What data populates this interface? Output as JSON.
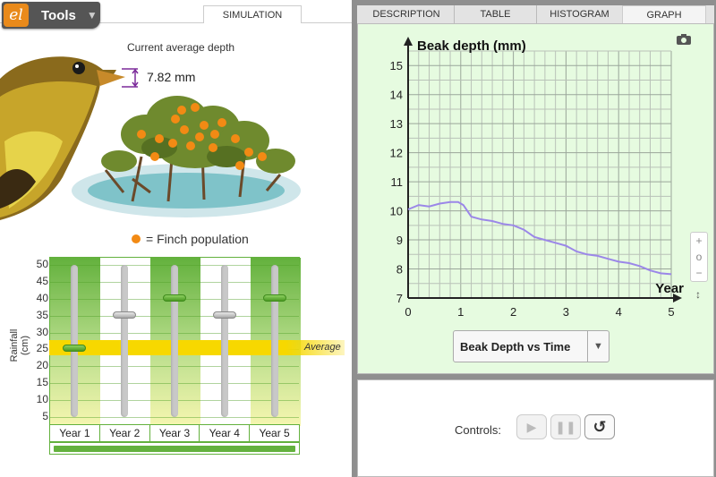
{
  "toolbar": {
    "logo_text": "el",
    "tools_label": "Tools",
    "caret": "▼"
  },
  "tabs": {
    "simulation": "SIMULATION",
    "description": "DESCRIPTION",
    "table": "TABLE",
    "histogram": "HISTOGRAM",
    "graph": "GRAPH"
  },
  "simulation": {
    "depth_label": "Current average depth",
    "depth_value": "7.82 mm",
    "legend": "= Finch population",
    "rainfall_axis_label": "Rainfall (cm)",
    "rainfall_ticks": [
      "50",
      "45",
      "40",
      "35",
      "30",
      "25",
      "20",
      "15",
      "10",
      "5"
    ],
    "average_label": "Average",
    "years": [
      "Year 1",
      "Year 2",
      "Year 3",
      "Year 4",
      "Year 5"
    ],
    "rainfall_values_cm": [
      25,
      35,
      40,
      35,
      40
    ],
    "progress_fraction": 1.0
  },
  "icons": {
    "camera": "camera-icon",
    "zoom_in": "+",
    "zoom_reset": "o",
    "zoom_out": "−",
    "vertical_scroll": "↕"
  },
  "graph": {
    "dropdown_label": "Beak Depth vs Time",
    "dropdown_caret": "▼"
  },
  "controls": {
    "label": "Controls:",
    "play": "▶",
    "pause": "❚❚",
    "reset": "↺"
  },
  "chart_data": {
    "type": "line",
    "title": "",
    "xlabel": "Year",
    "ylabel": "Beak depth (mm)",
    "xlim": [
      0,
      5
    ],
    "ylim": [
      7,
      15.5
    ],
    "xticks": [
      "0",
      "1",
      "2",
      "3",
      "4",
      "5"
    ],
    "yticks": [
      "7",
      "8",
      "9",
      "10",
      "11",
      "12",
      "13",
      "14",
      "15"
    ],
    "grid": true,
    "color": "#9b87e8",
    "x": [
      0,
      0.2,
      0.4,
      0.6,
      0.8,
      0.95,
      1.05,
      1.2,
      1.4,
      1.6,
      1.8,
      2.0,
      2.2,
      2.4,
      2.6,
      2.8,
      3.0,
      3.2,
      3.4,
      3.6,
      3.8,
      4.0,
      4.2,
      4.4,
      4.6,
      4.8,
      5.0
    ],
    "y": [
      10.05,
      10.2,
      10.15,
      10.25,
      10.3,
      10.3,
      10.2,
      9.8,
      9.7,
      9.65,
      9.55,
      9.5,
      9.35,
      9.1,
      9.0,
      8.9,
      8.8,
      8.6,
      8.5,
      8.45,
      8.35,
      8.25,
      8.2,
      8.1,
      7.95,
      7.85,
      7.82
    ]
  }
}
